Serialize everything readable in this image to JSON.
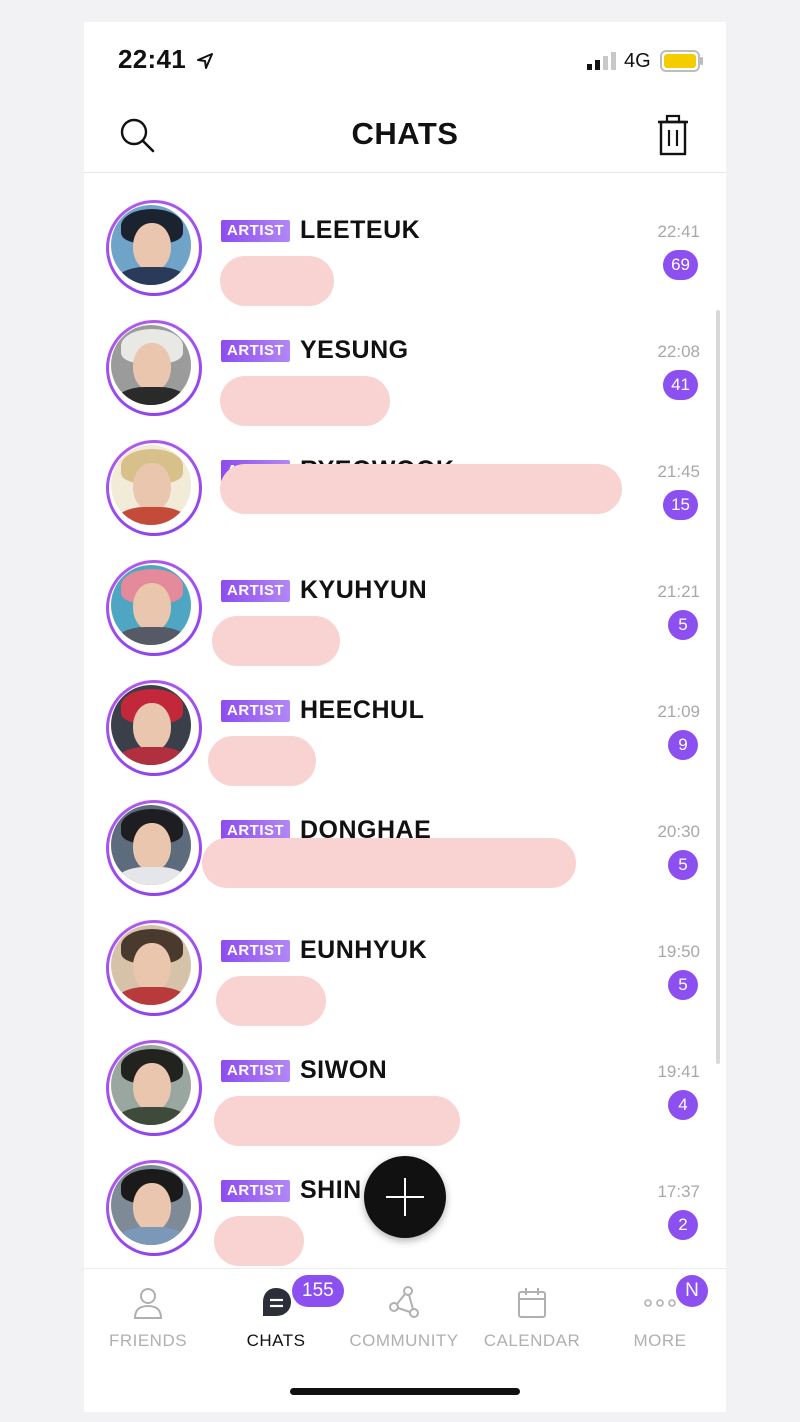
{
  "status": {
    "time": "22:41",
    "network": "4G"
  },
  "header": {
    "title": "CHATS"
  },
  "chats": [
    {
      "tag": "ARTIST",
      "name": "LEETEUK",
      "time": "22:41",
      "unread": "69"
    },
    {
      "tag": "ARTIST",
      "name": "YESUNG",
      "time": "22:08",
      "unread": "41"
    },
    {
      "tag": "ARTIST",
      "name": "RYEOWOOK",
      "time": "21:45",
      "unread": "15"
    },
    {
      "tag": "ARTIST",
      "name": "KYUHYUN",
      "time": "21:21",
      "unread": "5"
    },
    {
      "tag": "ARTIST",
      "name": "HEECHUL",
      "time": "21:09",
      "unread": "9"
    },
    {
      "tag": "ARTIST",
      "name": "DONGHAE",
      "time": "20:30",
      "unread": "5"
    },
    {
      "tag": "ARTIST",
      "name": "EUNHYUK",
      "time": "19:50",
      "unread": "5"
    },
    {
      "tag": "ARTIST",
      "name": "SIWON",
      "time": "19:41",
      "unread": "4"
    },
    {
      "tag": "ARTIST",
      "name": "SHIN",
      "time": "17:37",
      "unread": "2"
    }
  ],
  "tabs": {
    "friends": {
      "label": "FRIENDS",
      "icon": "person-icon"
    },
    "chats": {
      "label": "CHATS",
      "icon": "chat-bubble-icon",
      "badge": "155"
    },
    "community": {
      "label": "COMMUNITY",
      "icon": "network-icon"
    },
    "calendar": {
      "label": "CALENDAR",
      "icon": "calendar-icon"
    },
    "more": {
      "label": "MORE",
      "icon": "ellipsis-icon",
      "badge": "N"
    }
  },
  "colors": {
    "accent": "#8c4ff0",
    "redaction": "#f9d2d2"
  }
}
